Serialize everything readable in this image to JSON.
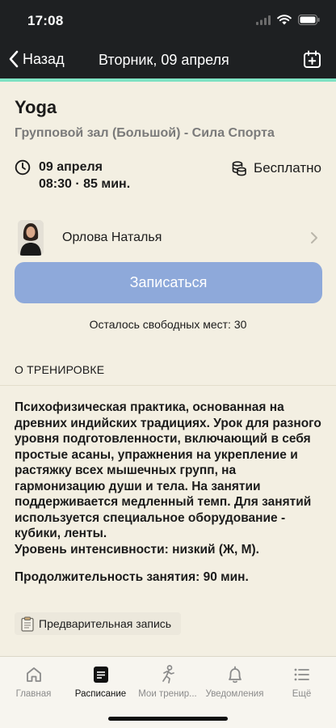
{
  "status_bar": {
    "time": "17:08"
  },
  "nav": {
    "back_label": "Назад",
    "title": "Вторник, 09 апреля"
  },
  "event": {
    "title": "Yoga",
    "place": "Групповой зал (Большой) - Сила Спорта",
    "date": "09 апреля",
    "time_duration": "08:30 · 85 мин.",
    "price": "Бесплатно"
  },
  "trainer": {
    "name": "Орлова Наталья"
  },
  "signup": {
    "button_label": "Записаться",
    "seats_text": "Осталось свободных мест: 30"
  },
  "about": {
    "section_title": "О ТРЕНИРОВКЕ",
    "description": "Психофизическая практика, основанная на древних индийских традициях. Урок для разного уровня подготовленности, включающий в себя простые асаны, упражнения на укрепление и растяжку всех мышечных групп, на гармонизацию души и тела. На занятии поддерживается медленный темп. Для занятий используется специальное оборудование - кубики, ленты.\nУровень интенсивности: низкий (Ж, М).",
    "duration": "Продолжительность занятия: 90 мин."
  },
  "prebook": {
    "icon": "clipboard-icon",
    "label": "Предварительная запись"
  },
  "tabs": [
    {
      "label": "Главная",
      "icon": "home-icon"
    },
    {
      "label": "Расписание",
      "icon": "schedule-icon"
    },
    {
      "label": "Мои тренир...",
      "icon": "runner-icon"
    },
    {
      "label": "Уведомления",
      "icon": "bell-icon"
    },
    {
      "label": "Ещё",
      "icon": "list-icon"
    }
  ],
  "colors": {
    "header_bg": "#1e2022",
    "accent": "#7ee3c4",
    "page_bg": "#f3efe2",
    "button": "#8ea9da"
  }
}
